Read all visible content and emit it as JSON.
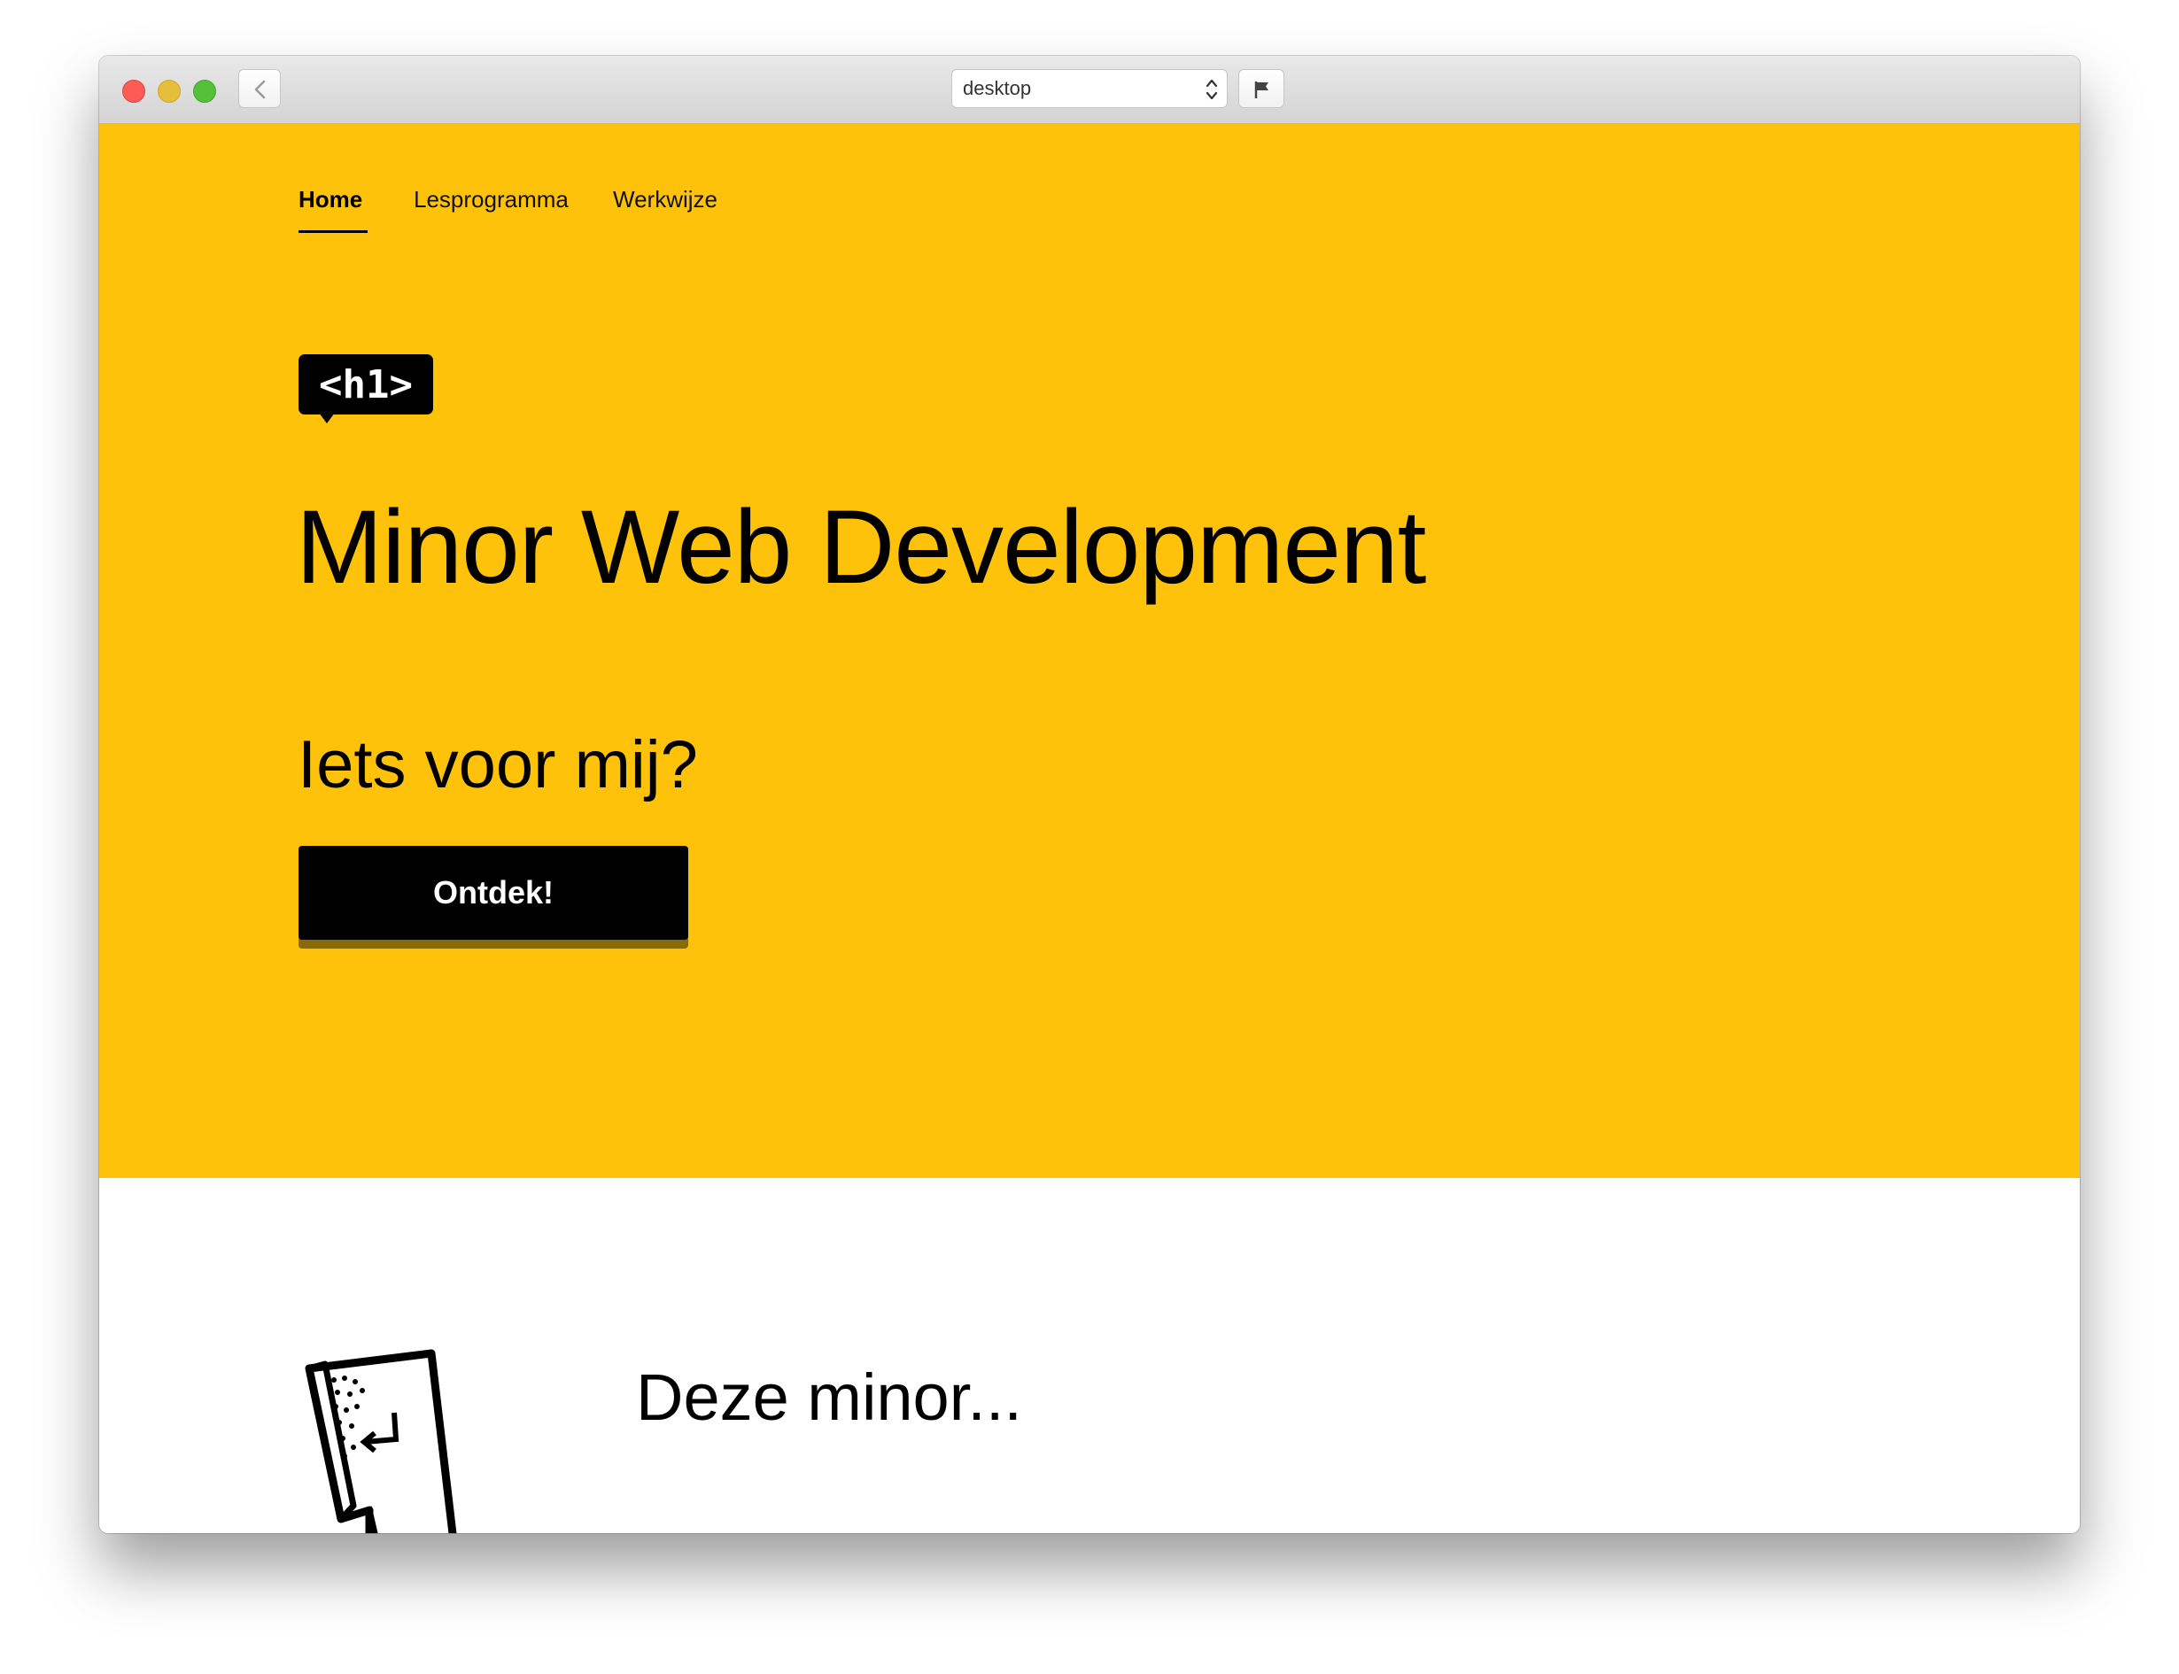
{
  "browser": {
    "device_select": "desktop"
  },
  "nav": {
    "items": [
      {
        "label": "Home",
        "active": true
      },
      {
        "label": "Lesprogramma",
        "active": false
      },
      {
        "label": "Werkwijze",
        "active": false
      }
    ]
  },
  "hero": {
    "badge": "<h1>",
    "title": "Minor Web Development",
    "subtitle": "Iets voor mij?",
    "cta_label": "Ontdek!",
    "background_color": "#fdc209"
  },
  "section2": {
    "heading": "Deze minor..."
  },
  "icons": [
    "close-icon",
    "minimize-icon",
    "maximize-icon",
    "back-arrow-icon",
    "select-chevrons-icon",
    "flag-icon",
    "phone-illustration"
  ]
}
